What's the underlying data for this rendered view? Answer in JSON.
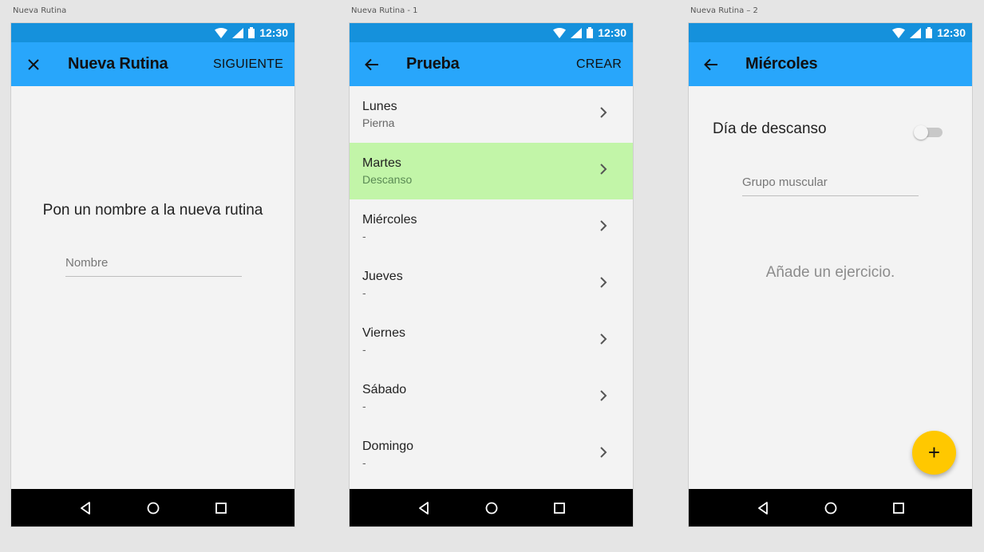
{
  "artboards": [
    "Nueva Rutina",
    "Nueva Rutina - 1",
    "Nueva Rutina – 2"
  ],
  "status_bar": {
    "time": "12:30"
  },
  "screen1": {
    "title": "Nueva Rutina",
    "action": "SIGUIENTE",
    "prompt": "Pon un nombre a la nueva rutina",
    "name_placeholder": "Nombre"
  },
  "screen2": {
    "title": "Prueba",
    "action": "CREAR",
    "days": [
      {
        "name": "Lunes",
        "detail": "Pierna"
      },
      {
        "name": "Martes",
        "detail": "Descanso"
      },
      {
        "name": "Miércoles",
        "detail": "-"
      },
      {
        "name": "Jueves",
        "detail": "-"
      },
      {
        "name": "Viernes",
        "detail": "-"
      },
      {
        "name": "Sábado",
        "detail": "-"
      },
      {
        "name": "Domingo",
        "detail": "-"
      }
    ],
    "selected_index": 1
  },
  "screen3": {
    "title": "Miércoles",
    "rest_day_label": "Día de descanso",
    "rest_day_enabled": false,
    "muscle_group_placeholder": "Grupo muscular",
    "empty_message": "Añade un ejercicio.",
    "fab_label": "+"
  },
  "colors": {
    "status_bar": "#1591dc",
    "app_bar": "#28a6fb",
    "selected_row": "#c2f5a8",
    "fab": "#ffc800"
  },
  "icons": {
    "close": "close-icon",
    "back": "arrow-back-icon",
    "chevron": "chevron-right-icon",
    "nav_back": "nav-back-icon",
    "nav_home": "nav-home-icon",
    "nav_recents": "nav-recents-icon"
  }
}
